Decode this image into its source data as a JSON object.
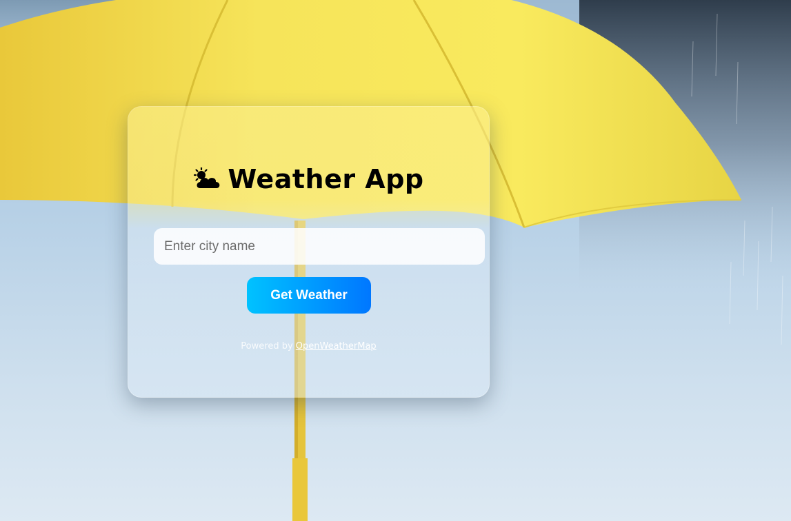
{
  "app": {
    "title": "Weather App",
    "title_icon": "sun-behind-cloud-icon"
  },
  "search": {
    "placeholder": "Enter city name",
    "value": ""
  },
  "actions": {
    "get_weather_label": "Get Weather"
  },
  "footer": {
    "powered_prefix": "Powered by ",
    "provider_link": "OpenWeatherMap"
  },
  "colors": {
    "button_gradient_start": "#00c2ff",
    "button_gradient_end": "#0077ff",
    "umbrella_yellow": "#f6e34a"
  }
}
